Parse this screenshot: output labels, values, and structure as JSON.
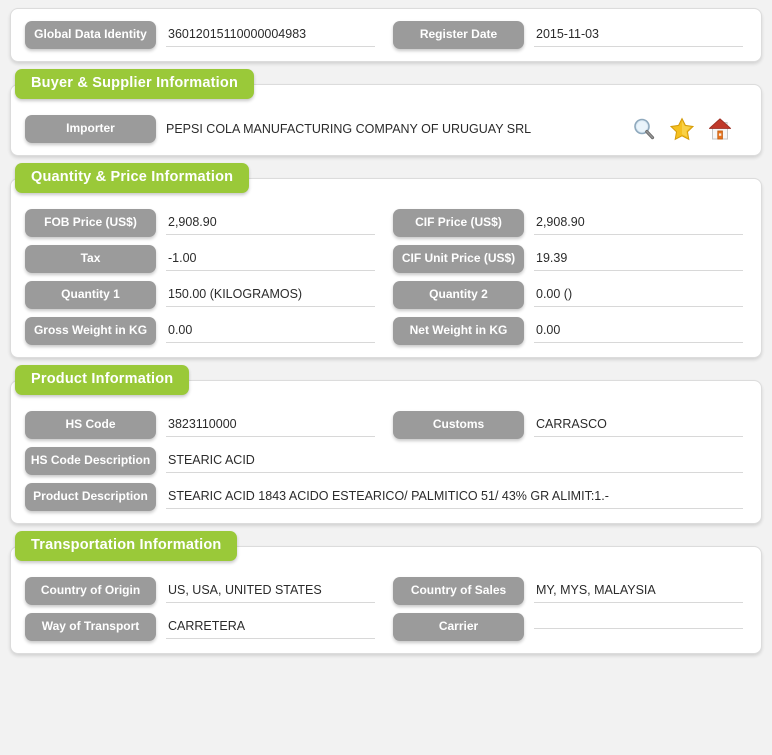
{
  "theme": {
    "accent_green": "#9ac939",
    "label_gray": "#9b9b9b",
    "page_background": "#f2f2f2",
    "card_background": "#ffffff",
    "value_text": "#2b2b2b"
  },
  "identity_section": {
    "fields": [
      {
        "label": "Global Data Identity",
        "value": "36012015110000004983"
      },
      {
        "label": "Register Date",
        "value": "2015-11-03"
      }
    ]
  },
  "buyer_supplier_section": {
    "title": "Buyer & Supplier Information",
    "importer": {
      "label": "Importer",
      "value": "PEPSI COLA MANUFACTURING COMPANY OF URUGUAY SRL"
    },
    "actions": [
      {
        "name": "search-icon",
        "title": "Search"
      },
      {
        "name": "star-icon",
        "title": "Favorite"
      },
      {
        "name": "home-icon",
        "title": "Home"
      }
    ]
  },
  "quantity_price_section": {
    "title": "Quantity & Price Information",
    "rows": [
      {
        "left": {
          "label": "FOB Price (US$)",
          "value": "2,908.90"
        },
        "right": {
          "label": "CIF Price (US$)",
          "value": "2,908.90"
        }
      },
      {
        "left": {
          "label": "Tax",
          "value": "-1.00"
        },
        "right": {
          "label": "CIF Unit Price (US$)",
          "value": "19.39"
        }
      },
      {
        "left": {
          "label": "Quantity 1",
          "value": "150.00 (KILOGRAMOS)"
        },
        "right": {
          "label": "Quantity 2",
          "value": "0.00 ()"
        }
      },
      {
        "left": {
          "label": "Gross Weight in KG",
          "value": "0.00"
        },
        "right": {
          "label": "Net Weight in KG",
          "value": "0.00"
        }
      }
    ]
  },
  "product_section": {
    "title": "Product Information",
    "row1": {
      "left": {
        "label": "HS Code",
        "value": "3823110000"
      },
      "right": {
        "label": "Customs",
        "value": "CARRASCO"
      }
    },
    "hs_code_description": {
      "label": "HS Code Description",
      "value": "STEARIC ACID"
    },
    "product_description": {
      "label": "Product Description",
      "value": "STEARIC ACID 1843 ACIDO ESTEARICO/ PALMITICO 51/ 43% GR ALIMIT:1.-"
    }
  },
  "transportation_section": {
    "title": "Transportation Information",
    "rows": [
      {
        "left": {
          "label": "Country of Origin",
          "value": "US, USA, UNITED STATES"
        },
        "right": {
          "label": "Country of Sales",
          "value": "MY, MYS, MALAYSIA"
        }
      },
      {
        "left": {
          "label": "Way of Transport",
          "value": "CARRETERA"
        },
        "right": {
          "label": "Carrier",
          "value": ""
        }
      }
    ]
  }
}
